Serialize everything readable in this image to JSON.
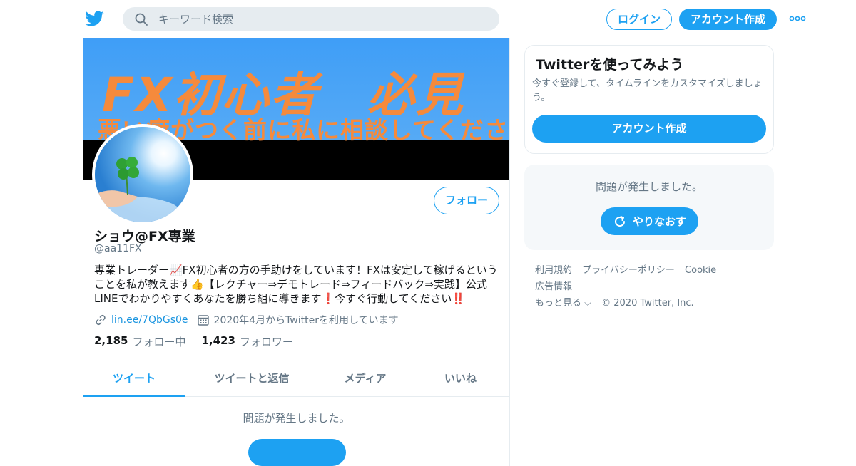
{
  "header": {
    "search_placeholder": "キーワード検索",
    "login_label": "ログイン",
    "signup_label": "アカウント作成"
  },
  "banner": {
    "title": "FX初心者　必見",
    "subtitle": "悪い癖がつく前に私に相談してください"
  },
  "profile": {
    "follow_label": "フォロー",
    "display_name": "ショウ@FX専業",
    "screen_name": "@aa11FX",
    "bio": "専業トレーダー📈FX初心者の方の手助けをしています！FXは安定して稼げるということを私が教えます👍【レクチャー⇒デモトレード⇒フィードバック⇒実践】公式LINEでわかりやすくあなたを勝ち組に導きます❗今すぐ行動してください‼️",
    "url": "lin.ee/7QbGs0e",
    "joined": "2020年4月からTwitterを利用しています",
    "following_count": "2,185",
    "following_label": "フォロー中",
    "followers_count": "1,423",
    "followers_label": "フォロワー"
  },
  "tabs": [
    {
      "label": "ツイート"
    },
    {
      "label": "ツイートと返信"
    },
    {
      "label": "メディア"
    },
    {
      "label": "いいね"
    }
  ],
  "timeline_error": "問題が発生しました。",
  "sidebar": {
    "title": "Twitterを使ってみよう",
    "description": "今すぐ登録して、タイムラインをカスタマイズしましょう。",
    "signup_label": "アカウント作成",
    "error_text": "問題が発生しました。",
    "retry_label": "やりなおす"
  },
  "footer": {
    "links": [
      "利用規約",
      "プライバシーポリシー",
      "Cookie",
      "広告情報",
      "もっと見る ⌵"
    ],
    "copyright": "© 2020 Twitter, Inc."
  },
  "colors": {
    "accent": "#1da1f2",
    "banner_text": "#f58a3c"
  }
}
